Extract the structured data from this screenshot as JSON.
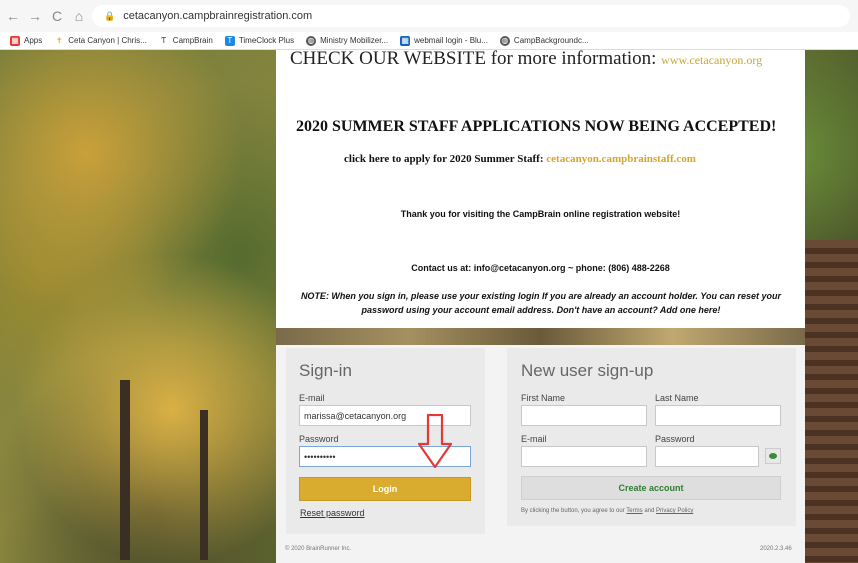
{
  "browser": {
    "nav": {
      "back": "←",
      "forward": "→",
      "reload": "C",
      "home": "⌂"
    },
    "url": "cetacanyon.campbrainregistration.com",
    "bookmarks": [
      {
        "label": "Apps",
        "icon": "apps-grid-icon",
        "color": "#e53935"
      },
      {
        "label": "Ceta Canyon | Chris...",
        "icon": "cross-icon",
        "color": "#f2a900"
      },
      {
        "label": "CampBrain",
        "icon": "campbrain-icon",
        "color": "#333333"
      },
      {
        "label": "TimeClock Plus",
        "icon": "timeclock-icon",
        "color": "#1e88e5"
      },
      {
        "label": "Ministry Mobilizer...",
        "icon": "globe-icon",
        "color": "#555555"
      },
      {
        "label": "webmail login - Blu...",
        "icon": "grid-icon",
        "color": "#1565c0"
      },
      {
        "label": "CampBackgroundc...",
        "icon": "globe-icon",
        "color": "#555555"
      }
    ]
  },
  "page": {
    "headline1": "CHECK OUR WEBSITE for more information:",
    "headline1_link": "www.cetacanyon.org",
    "headline2": "2020 SUMMER STAFF APPLICATIONS NOW BEING ACCEPTED!",
    "apply_text": "click here to apply for 2020 Summer Staff:",
    "apply_link": "cetacanyon.campbrainstaff.com",
    "thanks": "Thank you for visiting the CampBrain online registration website!",
    "contact": "Contact us at: info@cetacanyon.org ~ phone: (806) 488-2268",
    "note": "NOTE: When you sign in, please use your existing login If you are already an account holder. You can reset your password using your account email address. Don't have an account? Add one here!"
  },
  "signin": {
    "title": "Sign-in",
    "email_label": "E-mail",
    "email_value": "marissa@cetacanyon.org",
    "password_label": "Password",
    "password_value": "••••••••••",
    "login_button": "Login",
    "reset_link": "Reset password"
  },
  "signup": {
    "title": "New user sign-up",
    "first_name_label": "First Name",
    "last_name_label": "Last Name",
    "email_label": "E-mail",
    "password_label": "Password",
    "create_button": "Create account",
    "agree_prefix": "By clicking the button, you agree to our",
    "terms_link": "Terms",
    "and": "and",
    "privacy_link": "Privacy Policy"
  },
  "footer": {
    "copyright": "© 2020 BrainRunner Inc.",
    "version": "2020.2.3.46"
  },
  "colors": {
    "accent_gold": "#d9ac2f",
    "create_green": "#2e7d32",
    "arrow_red": "#e53935"
  }
}
